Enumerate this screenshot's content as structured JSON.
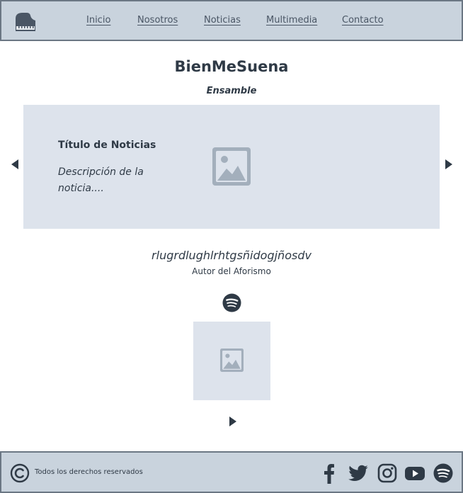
{
  "header": {
    "nav": [
      {
        "label": "Inicio"
      },
      {
        "label": "Nosotros"
      },
      {
        "label": "Noticias"
      },
      {
        "label": "Multimedia"
      },
      {
        "label": "Contacto"
      }
    ]
  },
  "main": {
    "title": "BienMeSuena",
    "subtitle": "Ensamble",
    "carousel": {
      "news_title": "Título de Noticias",
      "news_description": "Descripción de la noticia...."
    },
    "quote": {
      "text": "rlugrdlughlrhtgsñidogjñosdv",
      "author": "Autor del Aforismo"
    }
  },
  "footer": {
    "copyright": "Todos los derechos reservados",
    "social": [
      "facebook-icon",
      "twitter-icon",
      "instagram-icon",
      "youtube-icon",
      "spotify-icon"
    ]
  },
  "colors": {
    "header_bg": "#c9d3dd",
    "border": "#6b7784",
    "panel_bg": "#dde3ec",
    "placeholder": "#a3afbc",
    "text_dark": "#2f3a46"
  }
}
